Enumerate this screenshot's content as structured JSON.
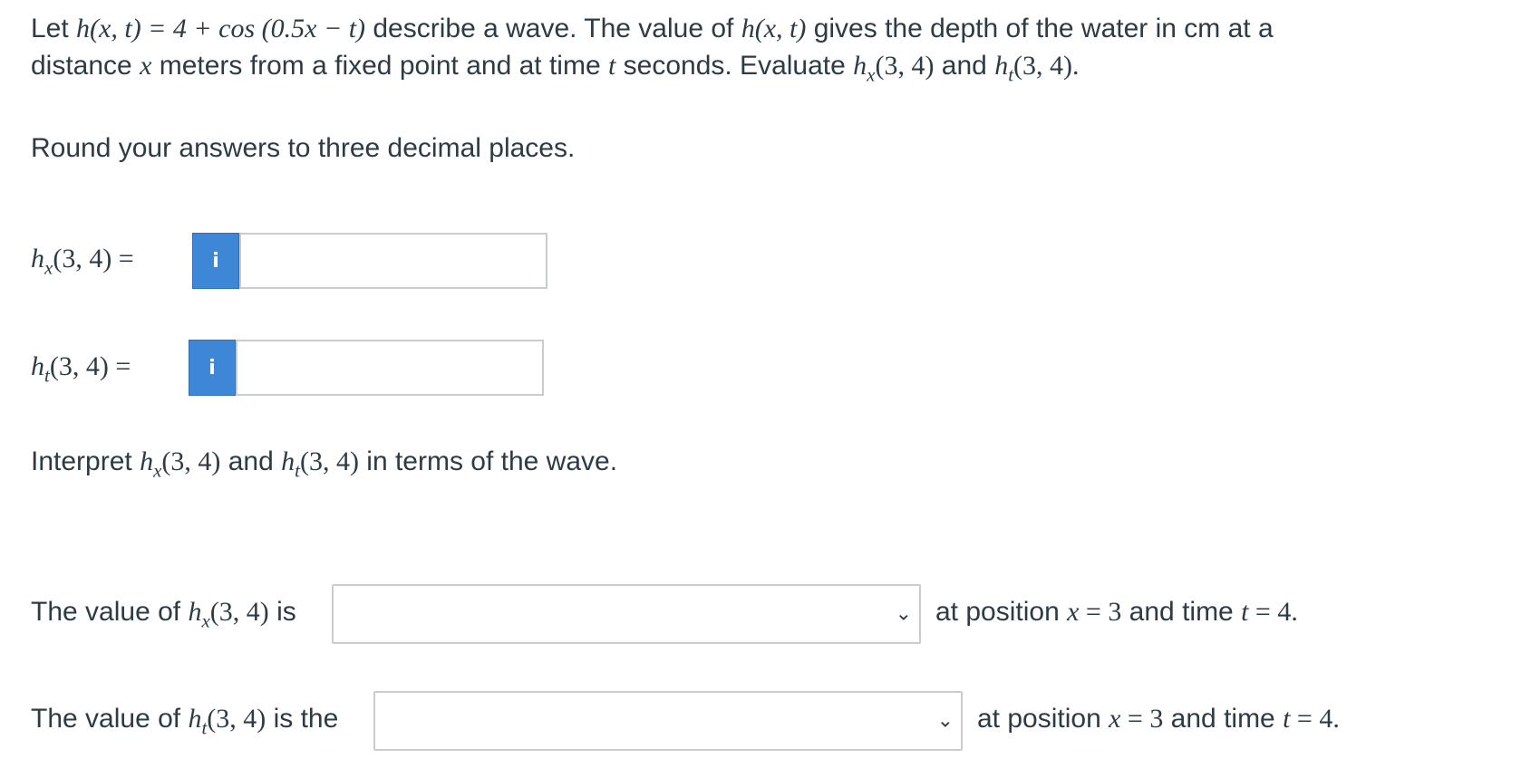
{
  "question": {
    "intro_let": "Let ",
    "func_def": "h(x, t)  =  4 + cos (0.5x − t)",
    "intro_rest": " describe a wave. The value of ",
    "h_xt": "h(x, t)",
    "intro_rest2": " gives the depth of the water in cm at a",
    "line2_a": "distance ",
    "var_x": "x",
    "line2_b": " meters from a fixed point and at time ",
    "var_t": "t",
    "line2_c": " seconds. Evaluate ",
    "hx_arg": "(3, 4)",
    "and": " and ",
    "ht_arg": "(3, 4).",
    "round_text": "Round your answers to three decimal places."
  },
  "answers": {
    "hx_label_h": "h",
    "hx_label_sub": "x",
    "hx_label_rest": "(3, 4)  =",
    "hx_value": "",
    "ht_label_h": "h",
    "ht_label_sub": "t",
    "ht_label_rest": "(3, 4)  =",
    "ht_value": "",
    "info_glyph": "i"
  },
  "interpret": {
    "pre": "Interpret ",
    "h": "h",
    "sub_x": "x",
    "arg1": "(3, 4)",
    "and": " and ",
    "sub_t": "t",
    "arg2": "(3, 4)",
    "post": " in terms of the wave."
  },
  "select1": {
    "pre": "The value of ",
    "h": "h",
    "sub": "x",
    "arg": "(3, 4)",
    "post_is": " is",
    "selected": "",
    "after_a": "at position ",
    "x": "x",
    "eq1": "  =  3",
    "mid": " and time ",
    "t": "t",
    "eq2": "  =  4."
  },
  "select2": {
    "pre": "The value of ",
    "h": "h",
    "sub": "t",
    "arg": "(3, 4)",
    "post_is": " is the",
    "selected": "",
    "after_a": "at position ",
    "x": "x",
    "eq1": "  =  3",
    "mid": " and time ",
    "t": "t",
    "eq2": "  =  4."
  },
  "icons": {
    "dropdown": "chevron-down-icon",
    "info": "info-icon"
  },
  "colors": {
    "info_button": "#3d87d6",
    "text": "#2d3b45",
    "border": "#c8cdd1"
  }
}
